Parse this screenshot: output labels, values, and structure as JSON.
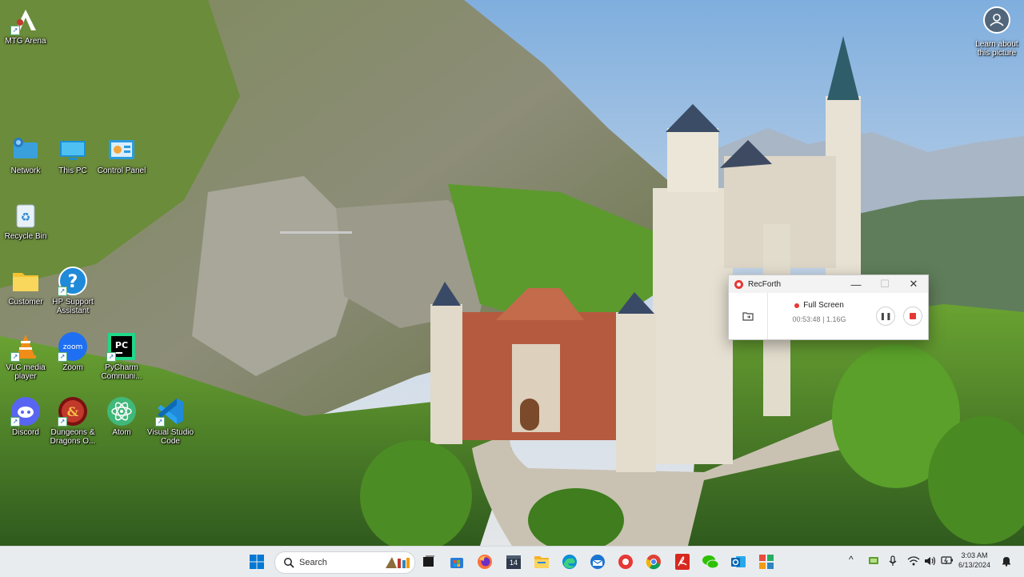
{
  "desktop": {
    "icons": [
      {
        "label": "MTG Arena",
        "icon": "mtg-arena-icon"
      },
      {
        "label": "Network",
        "icon": "network-icon"
      },
      {
        "label": "This PC",
        "icon": "this-pc-icon"
      },
      {
        "label": "Control Panel",
        "icon": "control-panel-icon"
      },
      {
        "label": "Recycle Bin",
        "icon": "recycle-bin-icon"
      },
      {
        "label": "Customer",
        "icon": "folder-icon"
      },
      {
        "label": "HP Support Assistant",
        "icon": "hp-support-icon"
      },
      {
        "label": "VLC media player",
        "icon": "vlc-icon"
      },
      {
        "label": "Zoom",
        "icon": "zoom-icon"
      },
      {
        "label": "PyCharm Communi...",
        "icon": "pycharm-icon"
      },
      {
        "label": "Discord",
        "icon": "discord-icon"
      },
      {
        "label": "Dungeons & Dragons O...",
        "icon": "dnd-icon"
      },
      {
        "label": "Atom",
        "icon": "atom-icon"
      },
      {
        "label": "Visual Studio Code",
        "icon": "vscode-icon"
      }
    ],
    "learn_about": "Learn about this picture"
  },
  "recforth": {
    "title": "RecForth",
    "mode": "Full Screen",
    "elapsed": "00:53:48",
    "size": "1.16G",
    "minimize": "—",
    "maximize": "☐",
    "close": "✕",
    "pause": "❚❚"
  },
  "taskbar": {
    "search_placeholder": "Search",
    "apps": [
      "start-icon",
      "search-icon",
      "task-view-icon",
      "store-icon",
      "firefox-icon",
      "calendar-icon",
      "file-explorer-icon",
      "edge-icon",
      "thunderbird-icon",
      "recforth-icon",
      "chrome-icon",
      "acrobat-icon",
      "wechat-icon",
      "outlook-icon",
      "widgets-icon"
    ],
    "calendar_day": "14",
    "tray_chevron": "^",
    "time": "3:03 AM",
    "date": "6/13/2024"
  },
  "colors": {
    "taskbar_bg": "#e9ecef",
    "record_red": "#e53935",
    "windows_blue": "#0078d4"
  }
}
